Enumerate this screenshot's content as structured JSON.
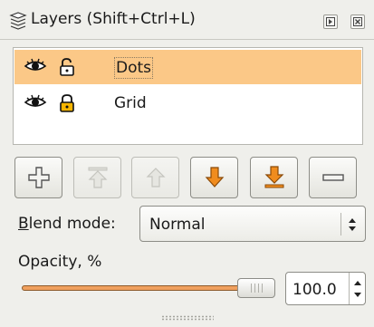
{
  "title": "Layers (Shift+Ctrl+L)",
  "icons": {
    "title": "layers-icon",
    "dock": "dock-icon",
    "close": "close-icon",
    "visible": "eye-icon",
    "unlocked": "unlocked-icon",
    "locked": "locked-icon",
    "add": "add-icon",
    "raise_top": "raise-to-top-icon",
    "raise": "raise-icon",
    "lower": "lower-icon",
    "lower_bottom": "lower-to-bottom-icon",
    "remove": "remove-icon"
  },
  "layers": [
    {
      "name": "Dots",
      "visible": true,
      "locked": false,
      "selected": true
    },
    {
      "name": "Grid",
      "visible": true,
      "locked": true,
      "selected": false
    }
  ],
  "blend": {
    "label_prefix": "B",
    "label_rest": "lend mode:",
    "value": "Normal"
  },
  "opacity": {
    "label": "Opacity, %",
    "value": "100.0",
    "fraction": 1.0
  },
  "colors": {
    "selection": "#fbc887",
    "accent": "#f08c1e",
    "slider_fill": "#f0a05e"
  }
}
